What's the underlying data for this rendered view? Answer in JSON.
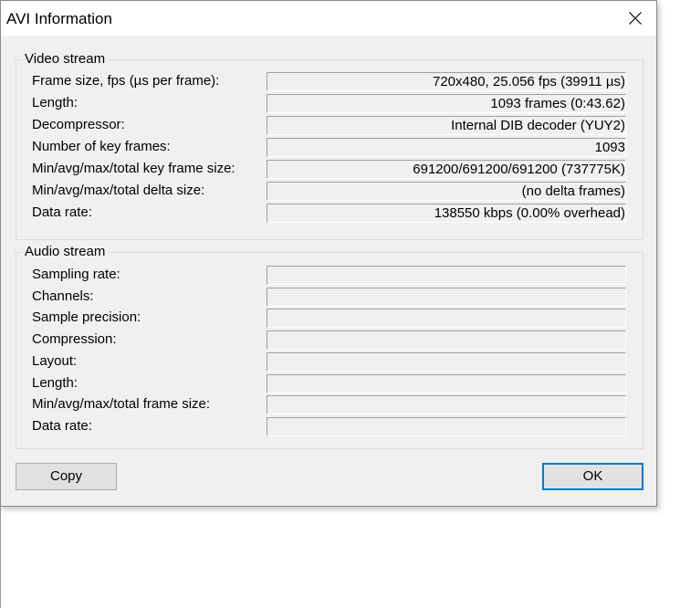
{
  "window": {
    "title": "AVI Information"
  },
  "video_stream": {
    "title": "Video stream",
    "rows": [
      {
        "label": "Frame size, fps (µs per frame):",
        "value": "720x480, 25.056 fps (39911 µs)"
      },
      {
        "label": "Length:",
        "value": "1093 frames (0:43.62)"
      },
      {
        "label": "Decompressor:",
        "value": "Internal DIB decoder (YUY2)"
      },
      {
        "label": "Number of key frames:",
        "value": "1093"
      },
      {
        "label": "Min/avg/max/total key frame size:",
        "value": "691200/691200/691200 (737775K)"
      },
      {
        "label": "Min/avg/max/total delta size:",
        "value": "(no delta frames)"
      },
      {
        "label": "Data rate:",
        "value": "138550 kbps (0.00% overhead)"
      }
    ]
  },
  "audio_stream": {
    "title": "Audio stream",
    "rows": [
      {
        "label": "Sampling rate:",
        "value": ""
      },
      {
        "label": "Channels:",
        "value": ""
      },
      {
        "label": "Sample precision:",
        "value": ""
      },
      {
        "label": "Compression:",
        "value": ""
      },
      {
        "label": "Layout:",
        "value": ""
      },
      {
        "label": "Length:",
        "value": ""
      },
      {
        "label": "Min/avg/max/total frame size:",
        "value": ""
      },
      {
        "label": "Data rate:",
        "value": ""
      }
    ]
  },
  "buttons": {
    "copy_label": "Copy",
    "ok_label": "OK"
  },
  "colors": {
    "dialog_bg": "#f0f0f0",
    "focus_border": "#0078d7"
  }
}
